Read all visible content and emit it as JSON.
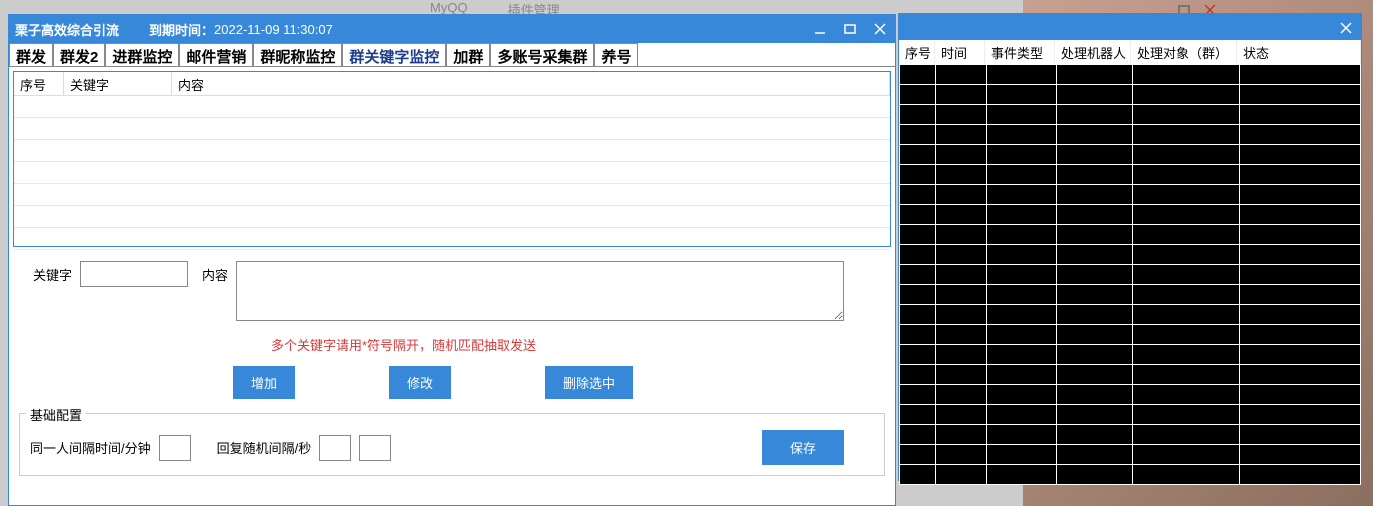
{
  "topbar": {
    "app": "MyQQ",
    "mgr": "插件管理"
  },
  "window1": {
    "title": "栗子高效综合引流",
    "expiry_label": "到期时间：",
    "expiry_value": "2022-11-09 11:30:07",
    "tabs": [
      "群发",
      "群发2",
      "进群监控",
      "邮件营销",
      "群昵称监控",
      "群关键字监控",
      "加群",
      "多账号采集群",
      "养号"
    ],
    "active_tab_index": 5,
    "grid_columns": {
      "seq": "序号",
      "keyword": "关键字",
      "content": "内容"
    },
    "form": {
      "keyword_label": "关键字",
      "content_label": "内容",
      "keyword_value": "",
      "content_value": ""
    },
    "tip": "多个关键字请用*符号隔开，随机匹配抽取发送",
    "buttons": {
      "add": "增加",
      "edit": "修改",
      "delete": "删除选中",
      "save": "保存"
    },
    "config": {
      "legend": "基础配置",
      "interval_person_label": "同一人间隔时间/分钟",
      "interval_person_value": "",
      "reply_interval_label": "回复随机间隔/秒",
      "reply_interval_value1": "",
      "reply_interval_value2": ""
    }
  },
  "window2": {
    "columns": {
      "seq": "序号",
      "time": "时间",
      "event_type": "事件类型",
      "bot": "处理机器人",
      "target": "处理对象（群）",
      "status": "状态"
    }
  }
}
